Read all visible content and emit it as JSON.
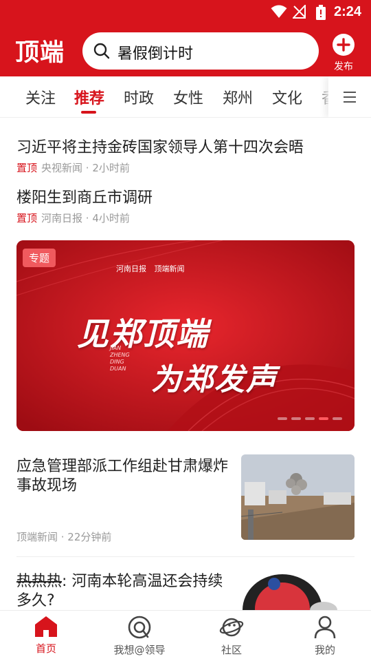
{
  "status_bar": {
    "time": "2:24"
  },
  "header": {
    "logo": "顶端",
    "search_text": "暑假倒计时",
    "publish_label": "发布",
    "brand_color": "#d7141c"
  },
  "tabs": [
    {
      "label": "关注"
    },
    {
      "label": "推荐"
    },
    {
      "label": "时政"
    },
    {
      "label": "女性"
    },
    {
      "label": "郑州"
    },
    {
      "label": "文化"
    },
    {
      "label": "香"
    }
  ],
  "pinned": [
    {
      "title": "习近平将主持金砖国家领导人第十四次会晤",
      "tag": "置顶",
      "meta": "央视新闻 · 2小时前"
    },
    {
      "title": "楼阳生到商丘市调研",
      "tag": "置顶",
      "meta": "河南日报 · 4小时前"
    }
  ],
  "banner": {
    "tag": "专题",
    "logos": [
      "河南日报",
      "顶端新闻"
    ],
    "title_line1": "见郑顶端",
    "title_line2": "为郑发声",
    "subtitle": "JIAN ZHENG DING DUAN"
  },
  "news": [
    {
      "title": "应急管理部派工作组赴甘肃爆炸事故现场",
      "meta": "顶端新闻 · 22分钟前"
    },
    {
      "title_struck": "热热热",
      "title_rest": ": 河南本轮高温还会持续多久?"
    }
  ],
  "bottom_nav": [
    {
      "label": "首页"
    },
    {
      "label": "我想@领导"
    },
    {
      "label": "社区"
    },
    {
      "label": "我的"
    }
  ]
}
